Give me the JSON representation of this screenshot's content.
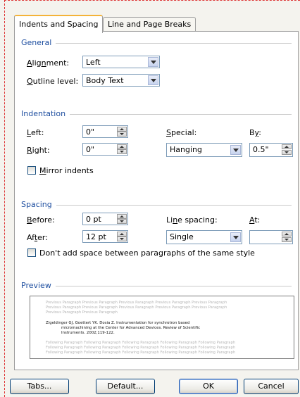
{
  "tabs": [
    {
      "label": "Indents and Spacing",
      "active": true
    },
    {
      "label": "Line and Page Breaks",
      "active": false
    }
  ],
  "general": {
    "title": "General",
    "alignment_label": "Alignment:",
    "alignment_value": "Left",
    "outline_label": "Outline level:",
    "outline_value": "Body Text"
  },
  "indentation": {
    "title": "Indentation",
    "left_label": "Left:",
    "left_value": "0\"",
    "right_label": "Right:",
    "right_value": "0\"",
    "special_label": "Special:",
    "special_value": "Hanging",
    "by_label": "By:",
    "by_value": "0.5\"",
    "mirror_label": "Mirror indents",
    "mirror_checked": false
  },
  "spacing": {
    "title": "Spacing",
    "before_label": "Before:",
    "before_value": "0 pt",
    "after_label": "After:",
    "after_value": "12 pt",
    "line_spacing_label": "Line spacing:",
    "line_spacing_value": "Single",
    "at_label": "At:",
    "at_value": "",
    "dont_add_label": "Don't add space between paragraphs of the same style",
    "dont_add_checked": false
  },
  "preview": {
    "title": "Preview",
    "previous_lines": [
      "Previous Paragraph Previous Paragraph Previous Paragraph Previous Paragraph Previous Paragraph",
      "Previous Paragraph Previous Paragraph Previous Paragraph Previous Paragraph Previous Paragraph",
      "Previous Paragraph Previous Paragraph"
    ],
    "sample_lines": [
      "Zigeldinger GJ, Goettert YK. Dosia Z. Instrumentation for synchrotron based",
      "micromachining at the Center for Advanced Devices. Review of Scientific",
      "Instruments. 2002;119-122."
    ],
    "following_lines": [
      "Following Paragraph Following Paragraph Following Paragraph Following Paragraph Following Paragraph",
      "Following Paragraph Following Paragraph Following Paragraph Following Paragraph Following Paragraph",
      "Following Paragraph Following Paragraph Following Paragraph Following Paragraph Following Paragraph"
    ]
  },
  "buttons": {
    "tabs": "Tabs...",
    "default": "Default...",
    "ok": "OK",
    "cancel": "Cancel"
  }
}
